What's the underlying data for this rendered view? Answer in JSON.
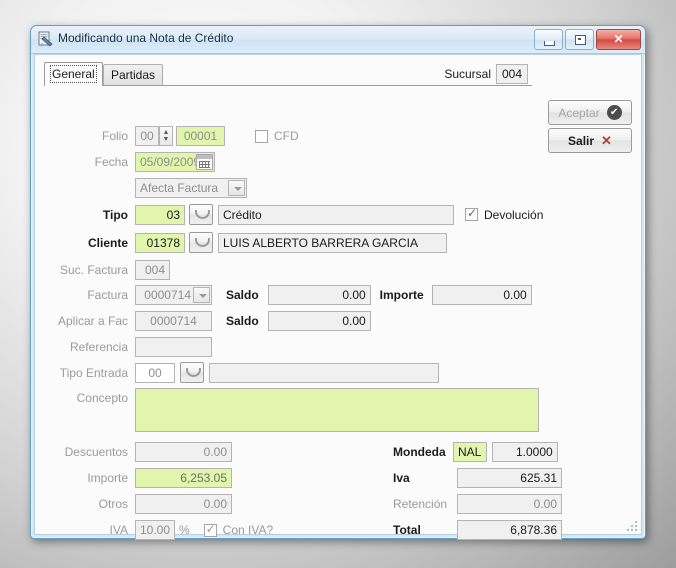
{
  "window": {
    "title": "Modificando una Nota de Crédito",
    "icon": "document-edit-icon",
    "minimize_glyph": "minimize-icon",
    "maximize_glyph": "maximize-icon",
    "close_glyph": "✕"
  },
  "tabs": [
    {
      "label": "General",
      "active": true
    },
    {
      "label": "Partidas",
      "active": false
    }
  ],
  "header": {
    "sucursal_label": "Sucursal",
    "sucursal_value": "004"
  },
  "buttons": {
    "aceptar": "Aceptar",
    "aceptar_icon": "✔",
    "salir": "Salir",
    "salir_icon": "✕"
  },
  "form": {
    "folio": {
      "label": "Folio",
      "serie_value": "00",
      "number_value": "00001"
    },
    "cfd": {
      "label": "CFD",
      "checked": false
    },
    "fecha": {
      "label": "Fecha",
      "value": "05/09/2009"
    },
    "afecta": {
      "value": "Afecta Factura"
    },
    "tipo": {
      "label": "Tipo",
      "code": "03",
      "description": "Crédito"
    },
    "devolucion": {
      "label": "Devolución",
      "checked": true
    },
    "cliente": {
      "label": "Cliente",
      "code": "01378",
      "name": "LUIS ALBERTO BARRERA GARCIA"
    },
    "suc_factura": {
      "label": "Suc. Factura",
      "value": "004"
    },
    "factura": {
      "label": "Factura",
      "value": "0000714",
      "saldo_label": "Saldo",
      "saldo_value": "0.00",
      "importe_label": "Importe",
      "importe_value": "0.00"
    },
    "aplicar_a_fac": {
      "label": "Aplicar a Fac",
      "value": "0000714",
      "saldo_label": "Saldo",
      "saldo_value": "0.00"
    },
    "referencia": {
      "label": "Referencia",
      "value": ""
    },
    "tipo_entrada": {
      "label": "Tipo Entrada",
      "code": "00",
      "description": ""
    },
    "concepto": {
      "label": "Concepto",
      "value": ""
    },
    "descuentos": {
      "label": "Descuentos",
      "value": "0.00"
    },
    "moneda": {
      "label": "Mondeda",
      "code": "NAL",
      "rate": "1.0000"
    },
    "importe": {
      "label": "Importe",
      "value": "6,253.05"
    },
    "iva_amount": {
      "label": "Iva",
      "value": "625.31"
    },
    "otros": {
      "label": "Otros",
      "value": "0.00"
    },
    "retencion": {
      "label": "Retención",
      "value": "0.00"
    },
    "iva_rate": {
      "label": "IVA",
      "value": "10.00",
      "unit": "%",
      "con_iva_label": "Con IVA?",
      "con_iva_checked": true
    },
    "total": {
      "label": "Total",
      "value": "6,878.36"
    }
  },
  "colors": {
    "field_green": "#e2f5ac",
    "field_grey": "#f0f0f0",
    "title_text": "#15314b",
    "close_red": "#cf4c43",
    "salir_x": "#c0392b"
  }
}
